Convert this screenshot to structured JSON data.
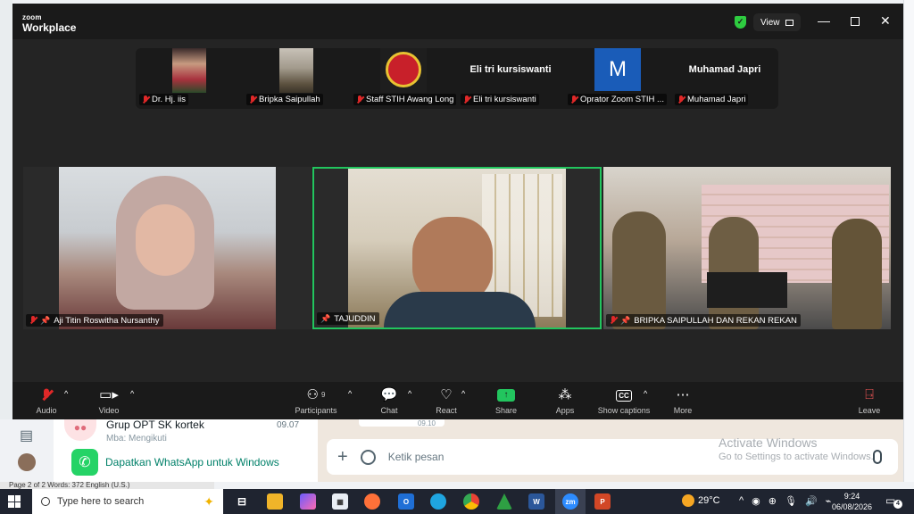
{
  "zoom": {
    "logo_small": "zoom",
    "logo_big": "Workplace",
    "view_label": "View",
    "window_controls": [
      "minimize",
      "maximize",
      "close"
    ],
    "strip": [
      {
        "name": "Dr. Hj. iis",
        "muted": true,
        "has_video": true
      },
      {
        "name": "Bripka Saipullah",
        "muted": true,
        "has_video": true
      },
      {
        "name": "Staff STIH Awang Long",
        "muted": true,
        "has_video": true
      },
      {
        "name": "Eli tri kursiswanti",
        "display_name": "Eli tri kursiswanti",
        "muted": true,
        "has_video": false
      },
      {
        "name": "Oprator Zoom STIH ...",
        "avatar_letter": "M",
        "muted": true,
        "has_video": false
      },
      {
        "name": "Muhamad Japri",
        "display_name": "Muhamad Japri",
        "muted": true,
        "has_video": false
      }
    ],
    "videos": [
      {
        "name": "Aji Titin Roswitha Nursanthy",
        "muted": true,
        "pinned": true,
        "active": false
      },
      {
        "name": "TAJUDDIN",
        "muted": false,
        "pinned": true,
        "active": true
      },
      {
        "name": "BRIPKA SAIPULLAH DAN REKAN REKAN",
        "muted": true,
        "pinned": true,
        "active": false
      }
    ],
    "toolbar": {
      "audio": "Audio",
      "video": "Video",
      "participants": "Participants",
      "participants_count": "9",
      "chat": "Chat",
      "react": "React",
      "share": "Share",
      "apps": "Apps",
      "captions": "Show captions",
      "captions_icon": "CC",
      "more": "More",
      "leave": "Leave"
    },
    "accent_green": "#22c55e",
    "muted_red": "#e02828"
  },
  "whatsapp": {
    "group_name": "Grup OPT SK kortek",
    "group_time": "09.07",
    "group_last": "Mba: Mengikuti",
    "promo": "Dapatkan WhatsApp untuk Windows",
    "input_placeholder": "Ketik pesan",
    "msg_time_stub": "09.10"
  },
  "activation": {
    "title": "Activate Windows",
    "subtitle": "Go to Settings to activate Windows."
  },
  "word_status": "Page 2 of 2    Words: 372    English (U.S.)",
  "taskbar": {
    "search_placeholder": "Type here to search",
    "temperature": "29°C",
    "time": "9:24",
    "date": "06/08/2026",
    "notifications": "4"
  }
}
